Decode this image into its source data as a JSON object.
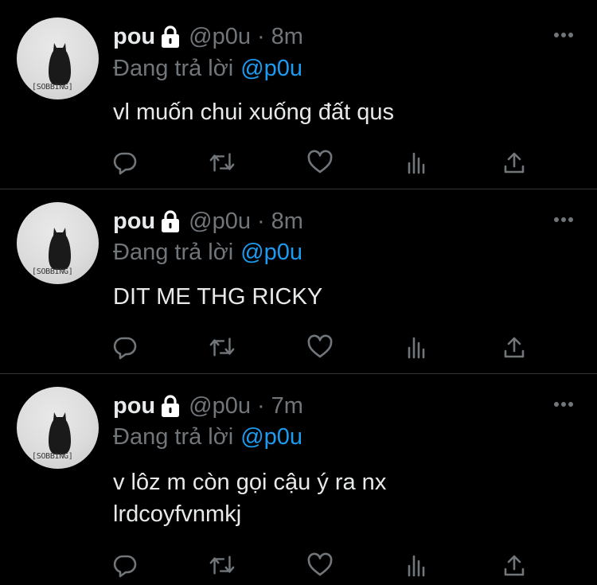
{
  "tweets": [
    {
      "name": "pou",
      "handle": "@p0u",
      "separator": "·",
      "time": "8m",
      "replying_label": "Đang trả lời",
      "replying_to": "@p0u",
      "avatar_tag": "[SOBBING]",
      "lines": [
        "vl muốn chui xuống đất qus"
      ]
    },
    {
      "name": "pou",
      "handle": "@p0u",
      "separator": "·",
      "time": "8m",
      "replying_label": "Đang trả lời",
      "replying_to": "@p0u",
      "avatar_tag": "[SOBBING]",
      "lines": [
        "DIT ME THG RICKY"
      ]
    },
    {
      "name": "pou",
      "handle": "@p0u",
      "separator": "·",
      "time": "7m",
      "replying_label": "Đang trả lời",
      "replying_to": "@p0u",
      "avatar_tag": "[SOBBING]",
      "lines": [
        "v lôz m còn gọi cậu ý ra nx",
        "lrdcoyfvnmkj"
      ]
    }
  ],
  "icons": {
    "lock": "lock-icon",
    "more": "more-icon",
    "reply": "reply-icon",
    "retweet": "retweet-icon",
    "like": "heart-icon",
    "analytics": "analytics-icon",
    "share": "share-icon"
  },
  "colors": {
    "background": "#000000",
    "text": "#e7e9ea",
    "secondary": "#71767b",
    "accent": "#1d9bf0",
    "divider": "#2f3336"
  }
}
